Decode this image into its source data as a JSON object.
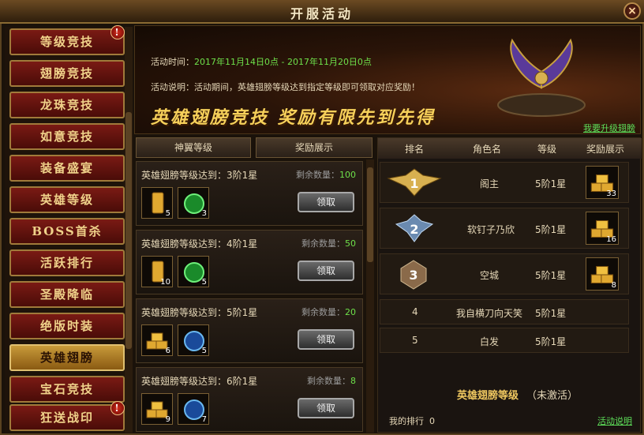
{
  "window": {
    "title": "开服活动",
    "close_label": "×"
  },
  "sidebar": {
    "items": [
      {
        "label": "等级竞技",
        "badge": "!"
      },
      {
        "label": "翅膀竞技",
        "badge": ""
      },
      {
        "label": "龙珠竞技",
        "badge": ""
      },
      {
        "label": "如意竞技",
        "badge": ""
      },
      {
        "label": "装备盛宴",
        "badge": ""
      },
      {
        "label": "英雄等级",
        "badge": ""
      },
      {
        "label": "BOSS首杀",
        "badge": ""
      },
      {
        "label": "活跃排行",
        "badge": ""
      },
      {
        "label": "圣殿降临",
        "badge": ""
      },
      {
        "label": "绝版时装",
        "badge": ""
      },
      {
        "label": "英雄翅膀",
        "badge": "",
        "active": true
      },
      {
        "label": "宝石竞技",
        "badge": ""
      },
      {
        "label": "狂送战印",
        "badge": "!"
      }
    ]
  },
  "banner": {
    "time_label": "活动时间：",
    "time_value": "2017年11月14日0点 - 2017年11月20日0点",
    "desc": "活动说明：活动期间，英雄翅膀等级达到指定等级即可领取对应奖励！",
    "slogan": "英雄翅膀竞技  奖励有限先到先得",
    "link": "我要升级翅膀"
  },
  "list": {
    "headers": [
      "神翼等级",
      "奖励展示"
    ],
    "cards": [
      {
        "title": "英雄翅膀等级达到：3阶1星",
        "remain_label": "剩余数量：",
        "remain": "100",
        "items": [
          {
            "icon": "gold-bar-icon",
            "count": "5"
          },
          {
            "icon": "green-orb-icon",
            "count": "3"
          }
        ],
        "button": "领取"
      },
      {
        "title": "英雄翅膀等级达到：4阶1星",
        "remain_label": "剩余数量：",
        "remain": "50",
        "items": [
          {
            "icon": "gold-bar-icon",
            "count": "10"
          },
          {
            "icon": "green-orb-icon",
            "count": "5"
          }
        ],
        "button": "领取"
      },
      {
        "title": "英雄翅膀等级达到：5阶1星",
        "remain_label": "剩余数量：",
        "remain": "20",
        "items": [
          {
            "icon": "gold-pile-icon",
            "count": "6"
          },
          {
            "icon": "blue-orb-icon",
            "count": "5"
          }
        ],
        "button": "领取"
      },
      {
        "title": "英雄翅膀等级达到：6阶1星",
        "remain_label": "剩余数量：",
        "remain": "8",
        "items": [
          {
            "icon": "gold-pile-icon",
            "count": "9"
          },
          {
            "icon": "blue-orb-icon",
            "count": "7"
          }
        ],
        "button": "领取"
      }
    ]
  },
  "ranking": {
    "headers": [
      "排名",
      "角色名",
      "等级",
      "奖励展示"
    ],
    "rows": [
      {
        "rank": "1",
        "name": "阁主",
        "level": "5阶1星",
        "prize_count": "33"
      },
      {
        "rank": "2",
        "name": "软钉子乃欣",
        "level": "5阶1星",
        "prize_count": "16"
      },
      {
        "rank": "3",
        "name": "空城",
        "level": "5阶1星",
        "prize_count": "8"
      },
      {
        "rank": "4",
        "name": "我自横刀向天笑",
        "level": "5阶1星"
      },
      {
        "rank": "5",
        "name": "白发",
        "level": "5阶1星"
      }
    ],
    "my_label": "英雄翅膀等级",
    "my_status": "（未激活）",
    "my_rank_label": "我的排行",
    "my_rank": "0",
    "rules_link": "活动说明"
  }
}
